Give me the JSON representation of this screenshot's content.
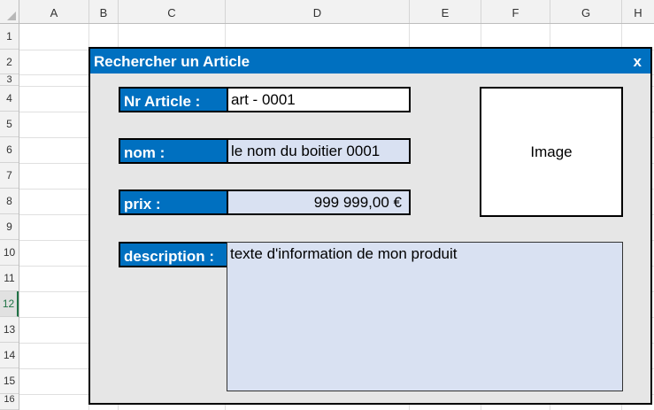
{
  "sheet": {
    "columns": [
      "A",
      "B",
      "C",
      "D",
      "E",
      "F",
      "G",
      "H"
    ],
    "rows": [
      "1",
      "2",
      "3",
      "4",
      "5",
      "6",
      "7",
      "8",
      "9",
      "10",
      "11",
      "12",
      "13",
      "14",
      "15",
      "16"
    ],
    "selected_row": "12"
  },
  "form": {
    "title": "Rechercher un Article",
    "close_label": "x",
    "image_label": "Image",
    "fields": {
      "nr_article": {
        "label": "Nr Article :",
        "value": "art - 0001"
      },
      "nom": {
        "label": "nom :",
        "value": "le nom du boitier 0001"
      },
      "prix": {
        "label": "prix :",
        "value": "999 999,00 €"
      },
      "description": {
        "label": "description :",
        "value": "texte d'information de mon produit"
      }
    }
  },
  "colors": {
    "accent": "#0070c0",
    "field_fill": "#d9e1f2",
    "form_bg": "#e6e6e6",
    "selected_row": "#217346"
  }
}
